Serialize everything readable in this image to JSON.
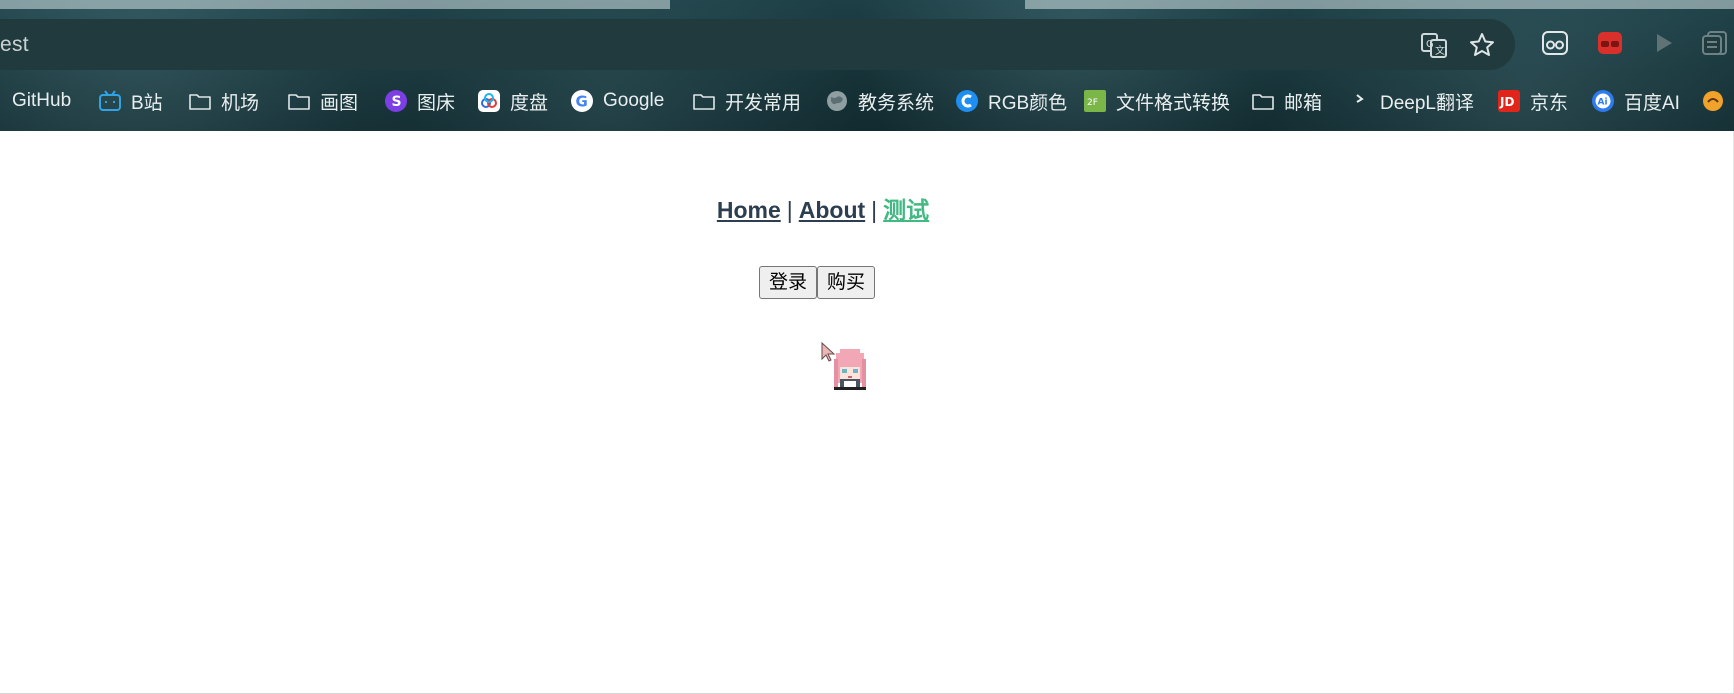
{
  "browser": {
    "address_text": "est",
    "toolbar_icons": [
      "translate-icon",
      "bookmark-star-icon",
      "extension-glasses-icon",
      "extension-red-icon",
      "play-icon",
      "reading-list-icon"
    ],
    "bookmarks": [
      {
        "label": "GitHub",
        "icon": "github-icon"
      },
      {
        "label": "B站",
        "icon": "bilibili-icon"
      },
      {
        "label": "机场",
        "icon": "folder-icon"
      },
      {
        "label": "画图",
        "icon": "folder-icon"
      },
      {
        "label": "图床",
        "icon": "image-host-icon"
      },
      {
        "label": "度盘",
        "icon": "baidu-pan-icon"
      },
      {
        "label": "Google",
        "icon": "google-icon"
      },
      {
        "label": "开发常用",
        "icon": "folder-icon"
      },
      {
        "label": "教务系统",
        "icon": "globe-icon"
      },
      {
        "label": "RGB颜色",
        "icon": "rgb-icon"
      },
      {
        "label": "文件格式转换",
        "icon": "file-convert-icon"
      },
      {
        "label": "邮箱",
        "icon": "folder-icon"
      },
      {
        "label": "DeepL翻译",
        "icon": "deepl-icon"
      },
      {
        "label": "京东",
        "icon": "jd-icon"
      },
      {
        "label": "百度AI",
        "icon": "baidu-ai-icon"
      }
    ]
  },
  "nav": {
    "links": [
      {
        "label": "Home",
        "active": false
      },
      {
        "label": "About",
        "active": false
      },
      {
        "label": "测试",
        "active": true
      }
    ],
    "separator": "|"
  },
  "buttons": {
    "login": "登录",
    "buy": "购买"
  },
  "colors": {
    "nav_text": "#2c3e50",
    "nav_active": "#42b983",
    "chrome_bg": "#163338"
  }
}
